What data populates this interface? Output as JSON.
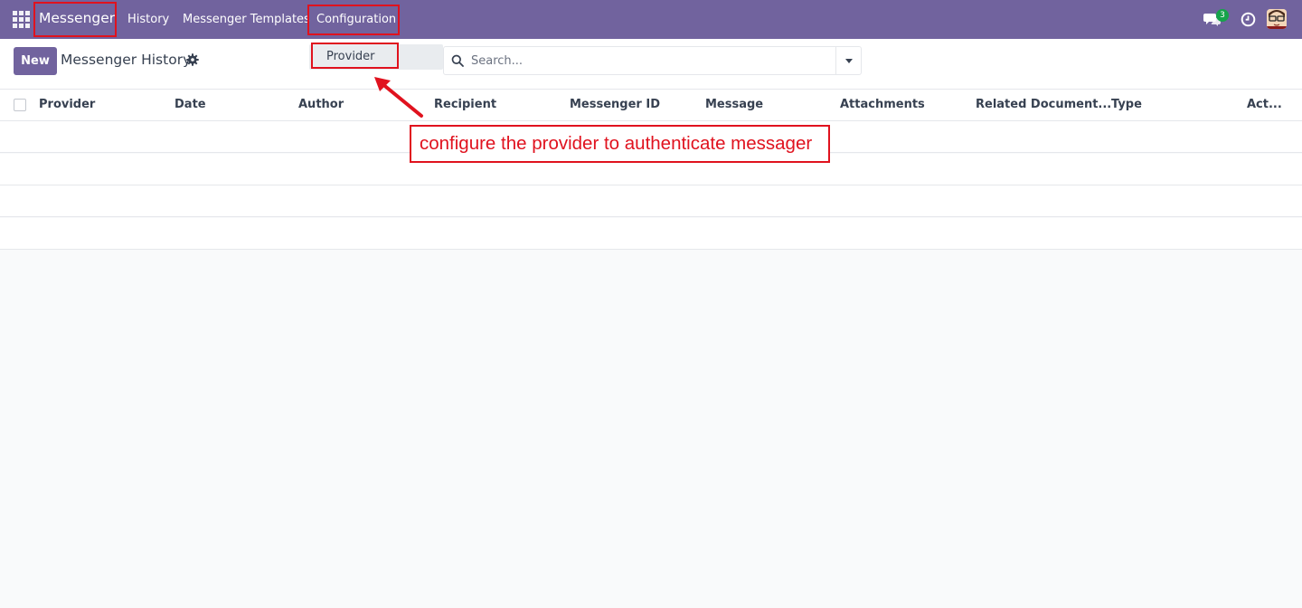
{
  "navbar": {
    "brand": "Messenger",
    "menu": [
      "History",
      "Messenger Templates",
      "Configuration"
    ],
    "chat_badge_count": "3",
    "icons": [
      "apps-grid-icon",
      "chat-icon",
      "clock-icon",
      "user-avatar"
    ]
  },
  "dropdown": {
    "items": [
      "Provider"
    ]
  },
  "control_panel": {
    "new_button": "New",
    "title": "Messenger History",
    "search_placeholder": "Search..."
  },
  "table": {
    "columns": [
      "Provider",
      "Date",
      "Author",
      "Recipient",
      "Messenger ID",
      "Message",
      "Attachments",
      "Related Document...",
      "Type",
      "Act..."
    ],
    "rows": []
  },
  "annotation": {
    "text": "configure the provider to authenticate messager"
  },
  "colors": {
    "brand": "#71639e",
    "highlight": "#e0121e",
    "badge": "#16a34a"
  }
}
